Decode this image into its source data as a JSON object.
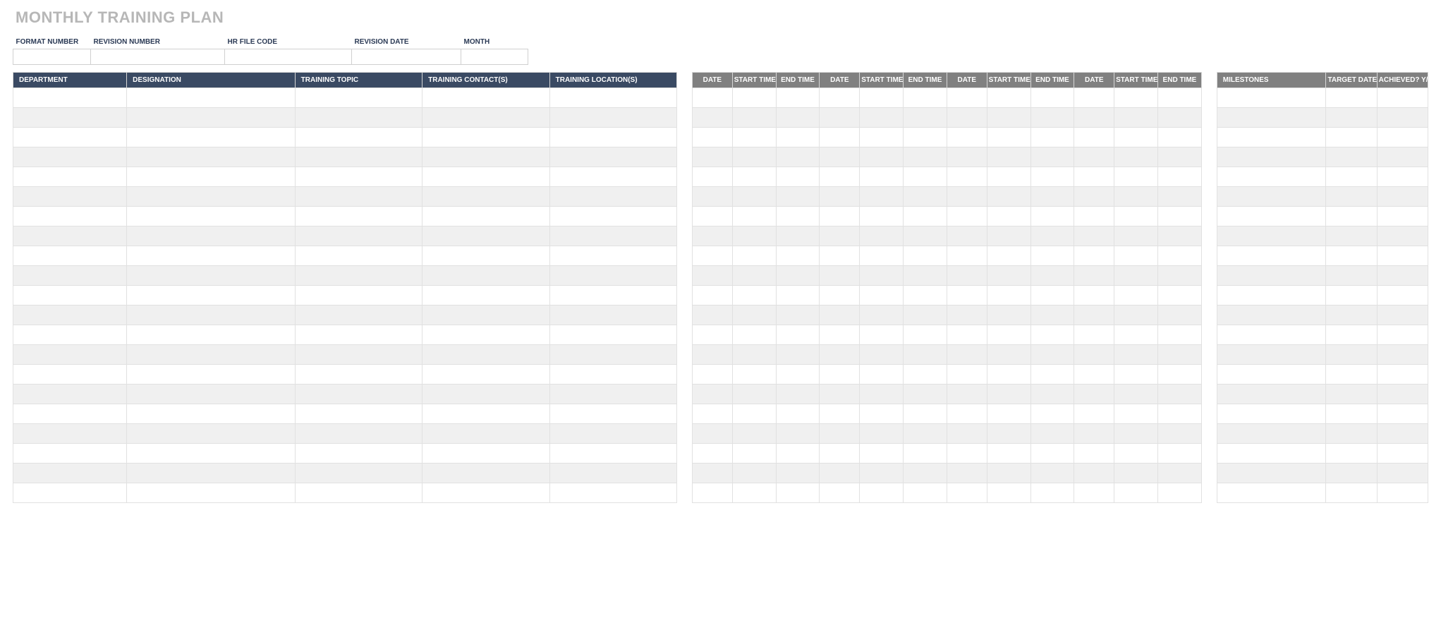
{
  "title": "MONTHLY TRAINING PLAN",
  "meta": {
    "labels": {
      "format_number": "FORMAT NUMBER",
      "revision_number": "REVISION NUMBER",
      "hr_file_code": "HR FILE CODE",
      "revision_date": "REVISION DATE",
      "month": "MONTH"
    },
    "values": {
      "format_number": "",
      "revision_number": "",
      "hr_file_code": "",
      "revision_date": "",
      "month": ""
    }
  },
  "headers": {
    "department": "DEPARTMENT",
    "designation": "DESIGNATION",
    "training_topic": "TRAINING TOPIC",
    "training_contacts": "TRAINING CONTACT(S)",
    "training_locations": "TRAINING LOCATION(S)",
    "date": "DATE",
    "start_time": "START TIME",
    "end_time": "END TIME",
    "milestones": "MILESTONES",
    "target_date": "TARGET DATE",
    "achieved": "ACHIEVED? Y/N"
  },
  "schedule_block_count": 4,
  "row_count": 21
}
